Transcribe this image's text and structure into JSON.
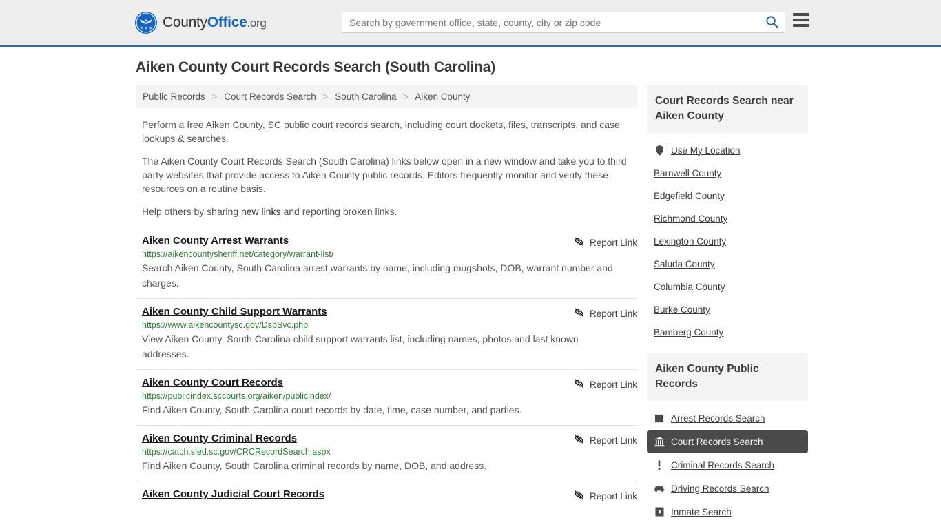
{
  "header": {
    "logo": {
      "icon": "eagle-seal-icon",
      "text_county": "County",
      "text_office": "Office",
      "text_org": ".org"
    },
    "search": {
      "placeholder": "Search by government office, state, county, city or zip code",
      "value": "",
      "icon": "search-icon"
    },
    "menu_icon": "hamburger-menu-icon",
    "accent_color": "#2e6da4"
  },
  "page": {
    "title": "Aiken County Court Records Search (South Carolina)"
  },
  "breadcrumb": {
    "separator": ">",
    "items": [
      {
        "label": "Public Records"
      },
      {
        "label": "Court Records Search"
      },
      {
        "label": "South Carolina"
      },
      {
        "label": "Aiken County"
      }
    ]
  },
  "intro": {
    "p1": "Perform a free Aiken County, SC public court records search, including court dockets, files, transcripts, and case lookups & searches.",
    "p2": "The Aiken County Court Records Search (South Carolina) links below open in a new window and take you to third party websites that provide access to Aiken County public records. Editors frequently monitor and verify these resources on a routine basis.",
    "p3_before": "Help others by sharing ",
    "p3_link": "new links",
    "p3_after": " and reporting broken links."
  },
  "results": {
    "report_label": "Report Link",
    "report_icon": "broken-link-icon",
    "items": [
      {
        "title": "Aiken County Arrest Warrants",
        "url": "https://aikencountysheriff.net/category/warrant-list/",
        "desc": "Search Aiken County, South Carolina arrest warrants by name, including mugshots, DOB, warrant number and charges."
      },
      {
        "title": "Aiken County Child Support Warrants",
        "url": "https://www.aikencountysc.gov/DspSvc.php",
        "desc": "View Aiken County, South Carolina child support warrants list, including names, photos and last known addresses."
      },
      {
        "title": "Aiken County Court Records",
        "url": "https://publicindex.sccourts.org/aiken/publicindex/",
        "desc": "Find Aiken County, South Carolina court records by date, time, case number, and parties."
      },
      {
        "title": "Aiken County Criminal Records",
        "url": "https://catch.sled.sc.gov/CRCRecordSearch.aspx",
        "desc": "Find Aiken County, South Carolina criminal records by name, DOB, and address."
      },
      {
        "title": "Aiken County Judicial Court Records",
        "url": "",
        "desc": ""
      }
    ]
  },
  "sidebar": {
    "nearby": {
      "heading": "Court Records Search near Aiken County",
      "items": [
        {
          "label": "Use My Location",
          "icon": "map-pin-icon"
        },
        {
          "label": "Barnwell County",
          "icon": ""
        },
        {
          "label": "Edgefield County",
          "icon": ""
        },
        {
          "label": "Richmond County",
          "icon": ""
        },
        {
          "label": "Lexington County",
          "icon": ""
        },
        {
          "label": "Saluda County",
          "icon": ""
        },
        {
          "label": "Columbia County",
          "icon": ""
        },
        {
          "label": "Burke County",
          "icon": ""
        },
        {
          "label": "Bamberg County",
          "icon": ""
        }
      ]
    },
    "public_records": {
      "heading": "Aiken County Public Records",
      "active_label": "Court Records Search",
      "items": [
        {
          "label": "Arrest Records Search",
          "icon": "square-icon",
          "active": false
        },
        {
          "label": "Court Records Search",
          "icon": "courthouse-icon",
          "active": true
        },
        {
          "label": "Criminal Records Search",
          "icon": "exclamation-icon",
          "active": false
        },
        {
          "label": "Driving Records Search",
          "icon": "car-icon",
          "active": false
        },
        {
          "label": "Inmate Search",
          "icon": "jail-icon",
          "active": false
        }
      ]
    }
  }
}
